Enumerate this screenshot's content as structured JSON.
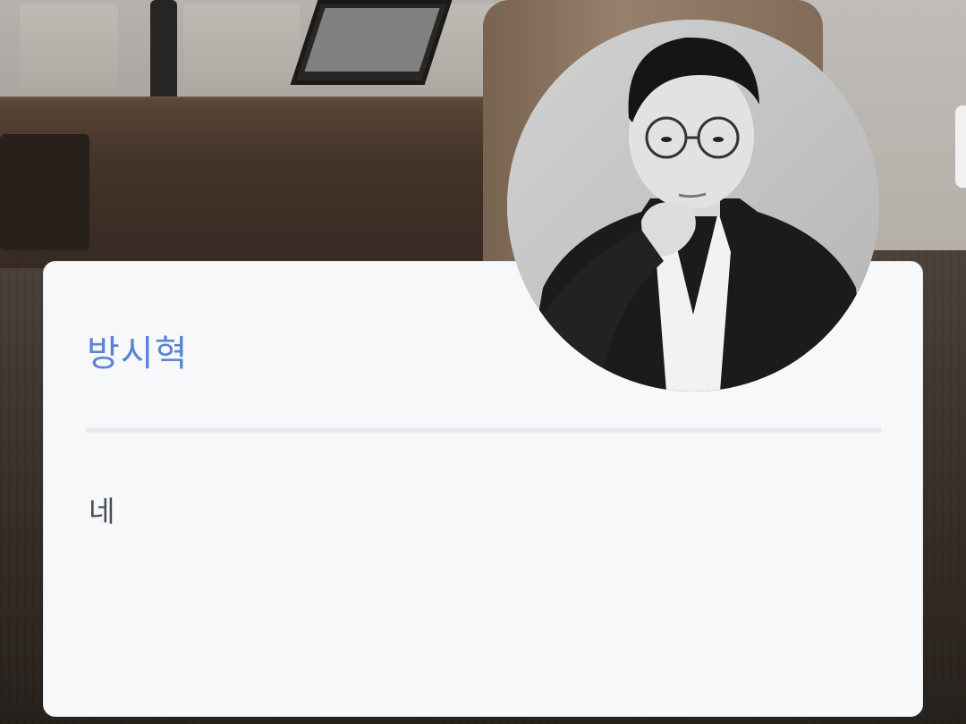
{
  "profile": {
    "name": "방시혁",
    "message": "네",
    "name_color": "#5b83d6",
    "message_color": "#4a4f55",
    "card_background": "#f6f8fa"
  },
  "icons": {
    "avatar": "person-photo"
  }
}
